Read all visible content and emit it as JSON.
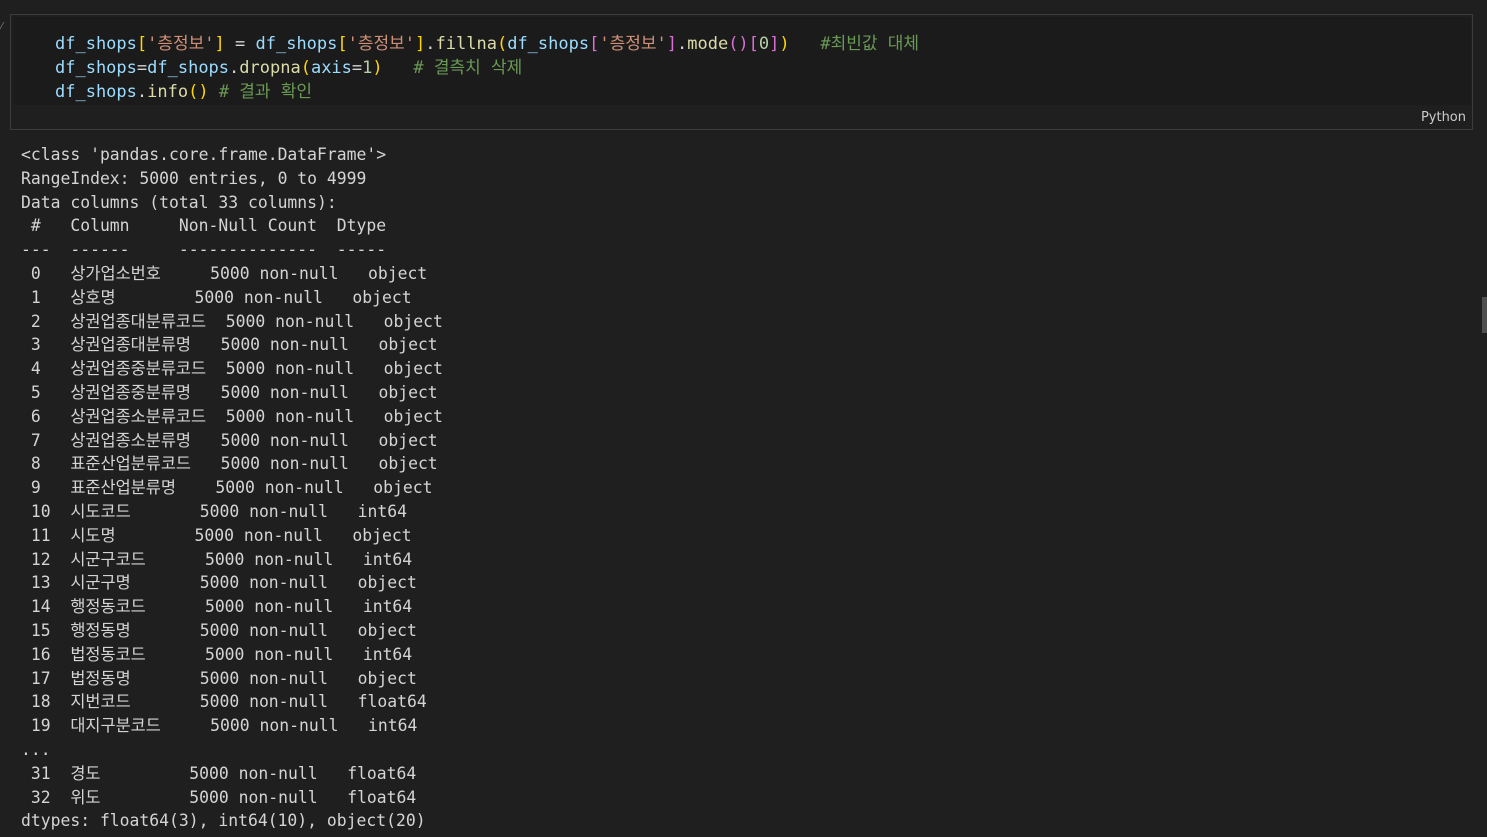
{
  "cell": {
    "language": "Python",
    "code_lines": [
      [
        {
          "t": "df_shops",
          "c": "var"
        },
        {
          "t": "[",
          "c": "br1"
        },
        {
          "t": "'층정보'",
          "c": "str"
        },
        {
          "t": "]",
          "c": "br1"
        },
        {
          "t": " = ",
          "c": "op"
        },
        {
          "t": "df_shops",
          "c": "var"
        },
        {
          "t": "[",
          "c": "br1"
        },
        {
          "t": "'층정보'",
          "c": "str"
        },
        {
          "t": "]",
          "c": "br1"
        },
        {
          "t": ".",
          "c": "op"
        },
        {
          "t": "fillna",
          "c": "fn"
        },
        {
          "t": "(",
          "c": "br1"
        },
        {
          "t": "df_shops",
          "c": "var"
        },
        {
          "t": "[",
          "c": "br2"
        },
        {
          "t": "'층정보'",
          "c": "str"
        },
        {
          "t": "]",
          "c": "br2"
        },
        {
          "t": ".",
          "c": "op"
        },
        {
          "t": "mode",
          "c": "fn"
        },
        {
          "t": "()",
          "c": "br2"
        },
        {
          "t": "[",
          "c": "br2"
        },
        {
          "t": "0",
          "c": "num"
        },
        {
          "t": "]",
          "c": "br2"
        },
        {
          "t": ")",
          "c": "br1"
        },
        {
          "t": "   #최빈값 대체",
          "c": "com"
        }
      ],
      [
        {
          "t": "df_shops",
          "c": "var"
        },
        {
          "t": "=",
          "c": "op"
        },
        {
          "t": "df_shops",
          "c": "var"
        },
        {
          "t": ".",
          "c": "op"
        },
        {
          "t": "dropna",
          "c": "fn"
        },
        {
          "t": "(",
          "c": "br1"
        },
        {
          "t": "axis",
          "c": "var"
        },
        {
          "t": "=",
          "c": "op"
        },
        {
          "t": "1",
          "c": "num"
        },
        {
          "t": ")",
          "c": "br1"
        },
        {
          "t": "   # 결측치 삭제",
          "c": "com"
        }
      ],
      [
        {
          "t": "df_shops",
          "c": "var"
        },
        {
          "t": ".",
          "c": "op"
        },
        {
          "t": "info",
          "c": "fn"
        },
        {
          "t": "()",
          "c": "br1"
        },
        {
          "t": " # 결과 확인",
          "c": "com"
        }
      ]
    ]
  },
  "output_lines": [
    "<class 'pandas.core.frame.DataFrame'>",
    "RangeIndex: 5000 entries, 0 to 4999",
    "Data columns (total 33 columns):",
    " #   Column     Non-Null Count  Dtype",
    "---  ------     --------------  -----",
    " 0   상가업소번호     5000 non-null   object",
    " 1   상호명        5000 non-null   object",
    " 2   상권업종대분류코드  5000 non-null   object",
    " 3   상권업종대분류명   5000 non-null   object",
    " 4   상권업종중분류코드  5000 non-null   object",
    " 5   상권업종중분류명   5000 non-null   object",
    " 6   상권업종소분류코드  5000 non-null   object",
    " 7   상권업종소분류명   5000 non-null   object",
    " 8   표준산업분류코드   5000 non-null   object",
    " 9   표준산업분류명    5000 non-null   object",
    " 10  시도코드       5000 non-null   int64",
    " 11  시도명        5000 non-null   object",
    " 12  시군구코드      5000 non-null   int64",
    " 13  시군구명       5000 non-null   object",
    " 14  행정동코드      5000 non-null   int64",
    " 15  행정동명       5000 non-null   object",
    " 16  법정동코드      5000 non-null   int64",
    " 17  법정동명       5000 non-null   object",
    " 18  지번코드       5000 non-null   float64",
    " 19  대지구분코드     5000 non-null   int64",
    "...",
    " 31  경도         5000 non-null   float64",
    " 32  위도         5000 non-null   float64",
    "dtypes: float64(3), int64(10), object(20)"
  ]
}
